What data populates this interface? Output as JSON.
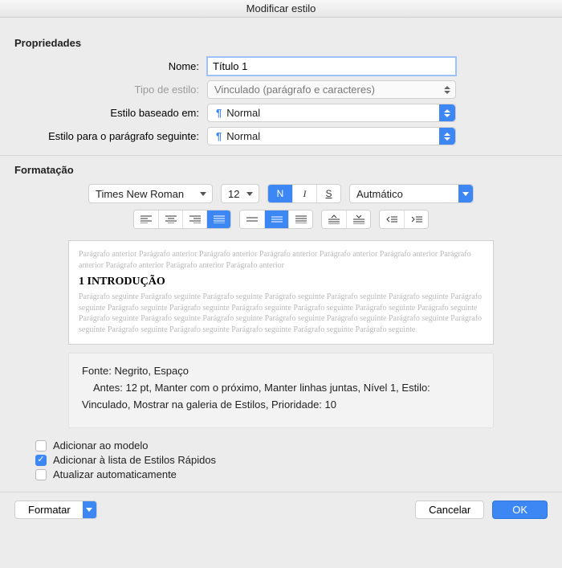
{
  "window": {
    "title": "Modificar estilo"
  },
  "sections": {
    "properties": "Propriedades",
    "formatting": "Formatação"
  },
  "labels": {
    "name": "Nome:",
    "type": "Tipo de estilo:",
    "based": "Estilo baseado em:",
    "next": "Estilo para o parágrafo seguinte:"
  },
  "values": {
    "name": "Título 1",
    "type": "Vinculado (parágrafo e caracteres)",
    "based": "Normal",
    "next": "Normal"
  },
  "formatting": {
    "font": "Times New Roman",
    "size": "12",
    "color": "Autmático",
    "bold_glyph": "N",
    "italic_glyph": "I",
    "underline_glyph": "S"
  },
  "preview": {
    "prev_text": "Parágrafo anterior Parágrafo anterior Parágrafo anterior Parágrafo anterior Parágrafo anterior Parágrafo anterior Parágrafo anterior Parágrafo anterior Parágrafo anterior Parágrafo anterior",
    "heading": "1 INTRODUÇÃO",
    "next_text": "Parágrafo seguinte Parágrafo seguinte Parágrafo seguinte Parágrafo seguinte Parágrafo seguinte Parágrafo seguinte Parágrafo seguinte Parágrafo seguinte Parágrafo seguinte Parágrafo seguinte Parágrafo seguinte Parágrafo seguinte Parágrafo seguinte Parágrafo seguinte Parágrafo seguinte Parágrafo seguinte Parágrafo seguinte Parágrafo seguinte Parágrafo seguinte Parágrafo seguinte Parágrafo seguinte Parágrafo seguinte Parágrafo seguinte Parágrafo seguinte Parágrafo seguinte"
  },
  "description": {
    "line1": "Fonte: Negrito, Espaço",
    "line2": "Antes:  12 pt, Manter com o próximo, Manter linhas juntas, Nível 1, Estilo:",
    "line3": "Vinculado, Mostrar na galeria de Estilos, Prioridade: 10"
  },
  "checks": {
    "add_template": "Adicionar ao modelo",
    "add_quick": "Adicionar à lista de Estilos Rápidos",
    "auto_update": "Atualizar automaticamente"
  },
  "buttons": {
    "format": "Formatar",
    "cancel": "Cancelar",
    "ok": "OK"
  }
}
